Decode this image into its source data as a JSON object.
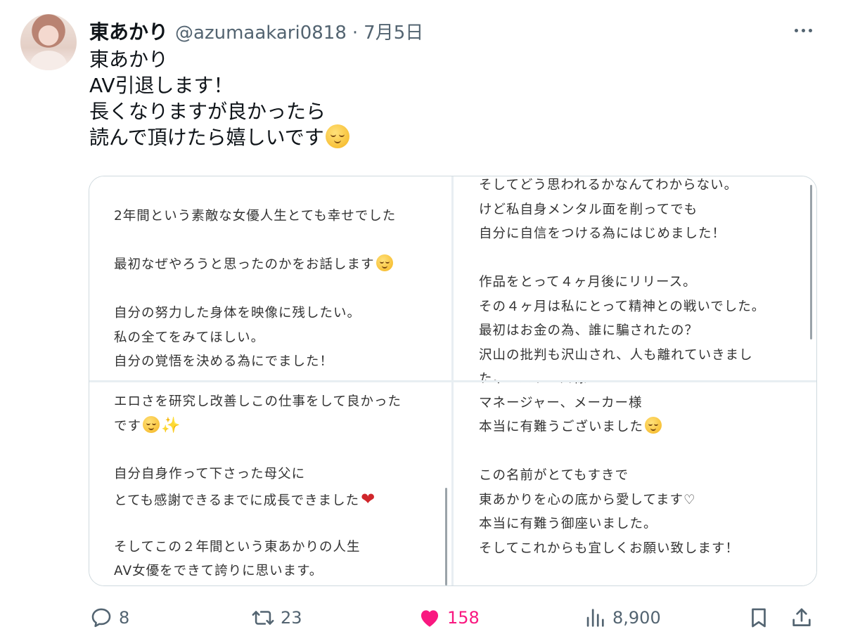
{
  "tweet": {
    "display_name": "東あかり",
    "handle": "@azumaakari0818",
    "separator": "·",
    "date": "7月5日",
    "text_lines": [
      "東あかり",
      "AV引退します！",
      "長くなりますが良かったら",
      "読んで頂けたら嬉しいです"
    ],
    "text_emoji": "relieved-face"
  },
  "media": {
    "panel1": [
      "2年間という素敵な女優人生とても幸せでした",
      "",
      "最初なぜやろうと思ったのかをお話します",
      "",
      "自分の努力した身体を映像に残したい。",
      "私の全てをみてほしい。",
      "自分の覚悟を決める為にでました！"
    ],
    "panel2": [
      "そしてどう思われるかなんてわからない。",
      "けど私自身メンタル面を削ってでも",
      "自分に自信をつける為にはじめました！",
      "",
      "作品をとって４ヶ月後にリリース。",
      "その４ヶ月は私にとって精神との戦いでした。",
      "最初はお金の為、誰に騙されたの？",
      "沢山の批判も沢山され、人も離れていきまし",
      "た。"
    ],
    "panel3": [
      "作品をよくする為",
      "エロさを研究し改善しこの仕事をして良かった",
      "です",
      "",
      "自分自身作って下さった母父に",
      "とても感謝できるまでに成長できました",
      "",
      "そしてこの２年間という東あかりの人生",
      "AV女優をできて誇りに思います。"
    ],
    "panel4": [
      "ティーパワーズ様",
      "マネージャー、メーカー様",
      "本当に有難うございました",
      "",
      "この名前がとてもすきで",
      "東あかりを心の底から愛してます♡",
      "本当に有難う御座いました。",
      "そしてこれからも宜しくお願い致します！"
    ],
    "symbols": {
      "sparkle": "✨",
      "heart": "❤"
    }
  },
  "actions": {
    "replies": "8",
    "retweets": "23",
    "likes": "158",
    "views": "8,900"
  },
  "colors": {
    "like_pink": "#f91880",
    "muted": "#536471",
    "text": "#0f1419"
  }
}
